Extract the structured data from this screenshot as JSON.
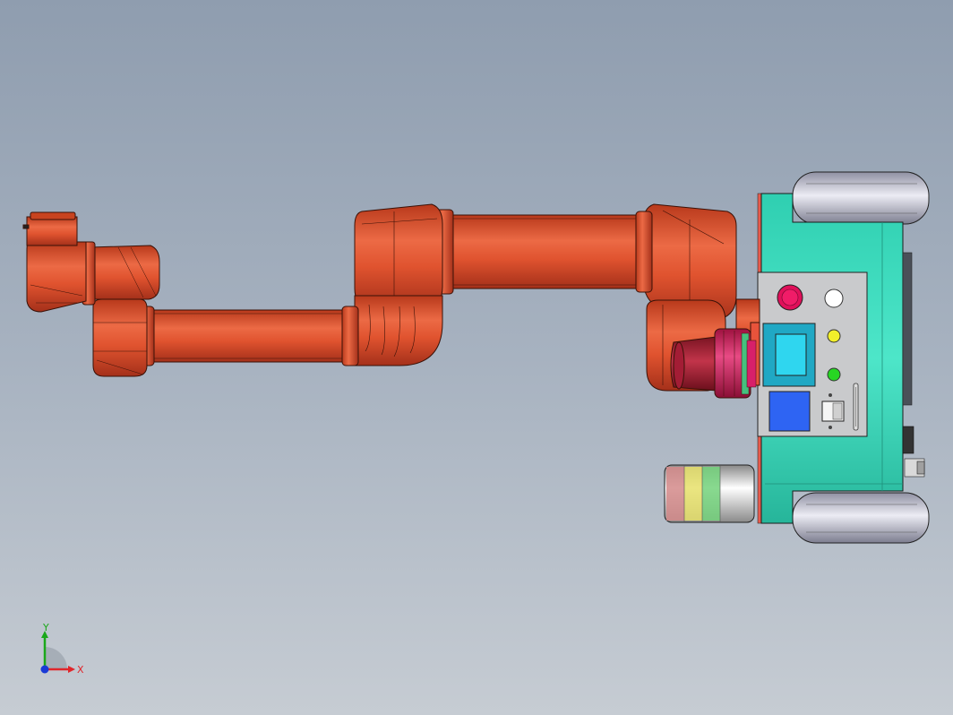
{
  "axes": {
    "x_label": "X",
    "y_label": "Y",
    "x_color": "#e0262b",
    "y_color": "#1aa81a",
    "z_color": "#1a3ad6"
  },
  "colors": {
    "background_top": "#8f9daf",
    "background_bottom": "#c6ccd3",
    "arm": "#e2522e",
    "arm_dark": "#b23518",
    "base": "#3fd9bd",
    "panel": "#c9cacc",
    "wheel": "#c7c8d6",
    "flange": "#d6266a",
    "estop": "#e0105a",
    "screen": "#2fd6ef",
    "blue_panel": "#2e64f3",
    "indicator_white": "#ffffff",
    "indicator_yellow": "#f2ef2a",
    "indicator_green": "#27d623"
  },
  "icons": {
    "triad": "xyz-axis-triad-icon"
  }
}
